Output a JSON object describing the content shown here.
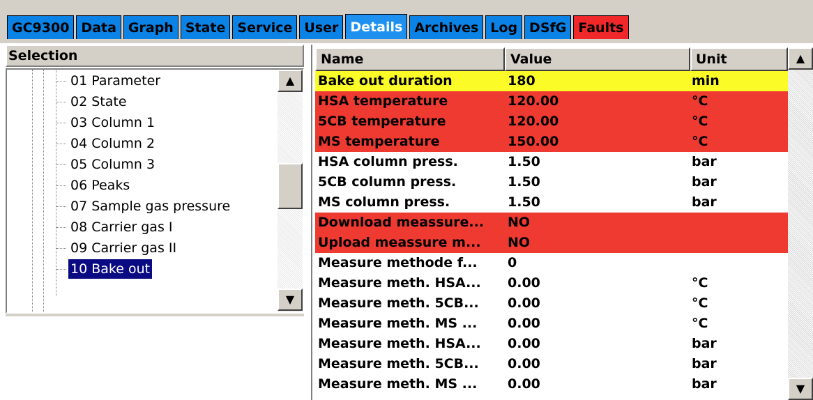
{
  "tabs": [
    {
      "label": "GC9300",
      "state": "normal"
    },
    {
      "label": "Data",
      "state": "normal"
    },
    {
      "label": "Graph",
      "state": "normal"
    },
    {
      "label": "State",
      "state": "normal"
    },
    {
      "label": "Service",
      "state": "normal"
    },
    {
      "label": "User",
      "state": "normal"
    },
    {
      "label": "Details",
      "state": "active"
    },
    {
      "label": "Archives",
      "state": "normal"
    },
    {
      "label": "Log",
      "state": "normal"
    },
    {
      "label": "DSfG",
      "state": "normal"
    },
    {
      "label": "Faults",
      "state": "fault"
    }
  ],
  "selection": {
    "header": "Selection",
    "items": [
      {
        "label": "01 Parameter",
        "selected": false
      },
      {
        "label": "02 State",
        "selected": false
      },
      {
        "label": "03 Column 1",
        "selected": false
      },
      {
        "label": "04 Column 2",
        "selected": false
      },
      {
        "label": "05 Column 3",
        "selected": false
      },
      {
        "label": "06 Peaks",
        "selected": false
      },
      {
        "label": "07 Sample gas pressure",
        "selected": false
      },
      {
        "label": "08 Carrier gas I",
        "selected": false
      },
      {
        "label": "09 Carrier gas II",
        "selected": false
      },
      {
        "label": "10 Bake out",
        "selected": true
      }
    ],
    "scroll_up_icon": "triangle-up",
    "scroll_down_icon": "triangle-down"
  },
  "table": {
    "columns": [
      "Name",
      "Value",
      "Unit"
    ],
    "rows": [
      {
        "name": "Bake out duration",
        "value": "180",
        "unit": "min",
        "highlight": "yellow"
      },
      {
        "name": "HSA temperature",
        "value": "120.00",
        "unit": "°C",
        "highlight": "red"
      },
      {
        "name": "5CB temperature",
        "value": "120.00",
        "unit": "°C",
        "highlight": "red"
      },
      {
        "name": "MS temperature",
        "value": "150.00",
        "unit": "°C",
        "highlight": "red"
      },
      {
        "name": "HSA column press.",
        "value": "1.50",
        "unit": "bar",
        "highlight": "white"
      },
      {
        "name": "5CB column press.",
        "value": "1.50",
        "unit": "bar",
        "highlight": "white"
      },
      {
        "name": "MS column press.",
        "value": "1.50",
        "unit": "bar",
        "highlight": "white"
      },
      {
        "name": "Download meassure...",
        "value": "NO",
        "unit": "",
        "highlight": "red"
      },
      {
        "name": "Upload meassure m...",
        "value": "NO",
        "unit": "",
        "highlight": "red"
      },
      {
        "name": "Measure methode f...",
        "value": "0",
        "unit": "",
        "highlight": "white"
      },
      {
        "name": "Measure meth. HSA...",
        "value": "0.00",
        "unit": "°C",
        "highlight": "white"
      },
      {
        "name": "Measure meth. 5CB...",
        "value": "0.00",
        "unit": "°C",
        "highlight": "white"
      },
      {
        "name": "Measure meth. MS ...",
        "value": "0.00",
        "unit": "°C",
        "highlight": "white"
      },
      {
        "name": "Measure meth. HSA...",
        "value": "0.00",
        "unit": "bar",
        "highlight": "white"
      },
      {
        "name": "Measure meth. 5CB...",
        "value": "0.00",
        "unit": "bar",
        "highlight": "white"
      },
      {
        "name": "Measure meth. MS ...",
        "value": "0.00",
        "unit": "bar",
        "highlight": "white"
      }
    ],
    "scroll_up_icon": "triangle-up",
    "scroll_down_icon": "triangle-down"
  },
  "colors": {
    "tab_blue": "#0a82e6",
    "tab_fault": "#f0282a",
    "row_yellow": "#fbfb28",
    "row_red": "#ef3a32",
    "selected_bg": "#0a0a82",
    "chrome": "#d4d0c8"
  }
}
